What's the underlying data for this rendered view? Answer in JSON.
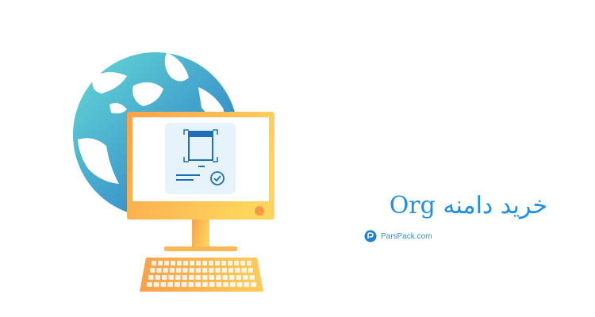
{
  "headline": {
    "text": "خرید دامنه Org",
    "color": "#1d8fe8"
  },
  "brand": {
    "name": "ParsPack.com",
    "icon": "parspack-logo-icon",
    "color": "#2f8fd8"
  },
  "illustration": {
    "globe_icon": "globe-icon",
    "monitor_icon": "monitor-icon",
    "keyboard_icon": "keyboard-icon",
    "document_icon": "document-icon",
    "check_icon": "check-circle-icon",
    "colors": {
      "globe_light": "#5dd3d6",
      "globe_dark": "#2c7cc9",
      "monitor_light": "#ffd05a",
      "monitor_dark": "#f9a04a",
      "card": "#e6f3fb"
    }
  }
}
